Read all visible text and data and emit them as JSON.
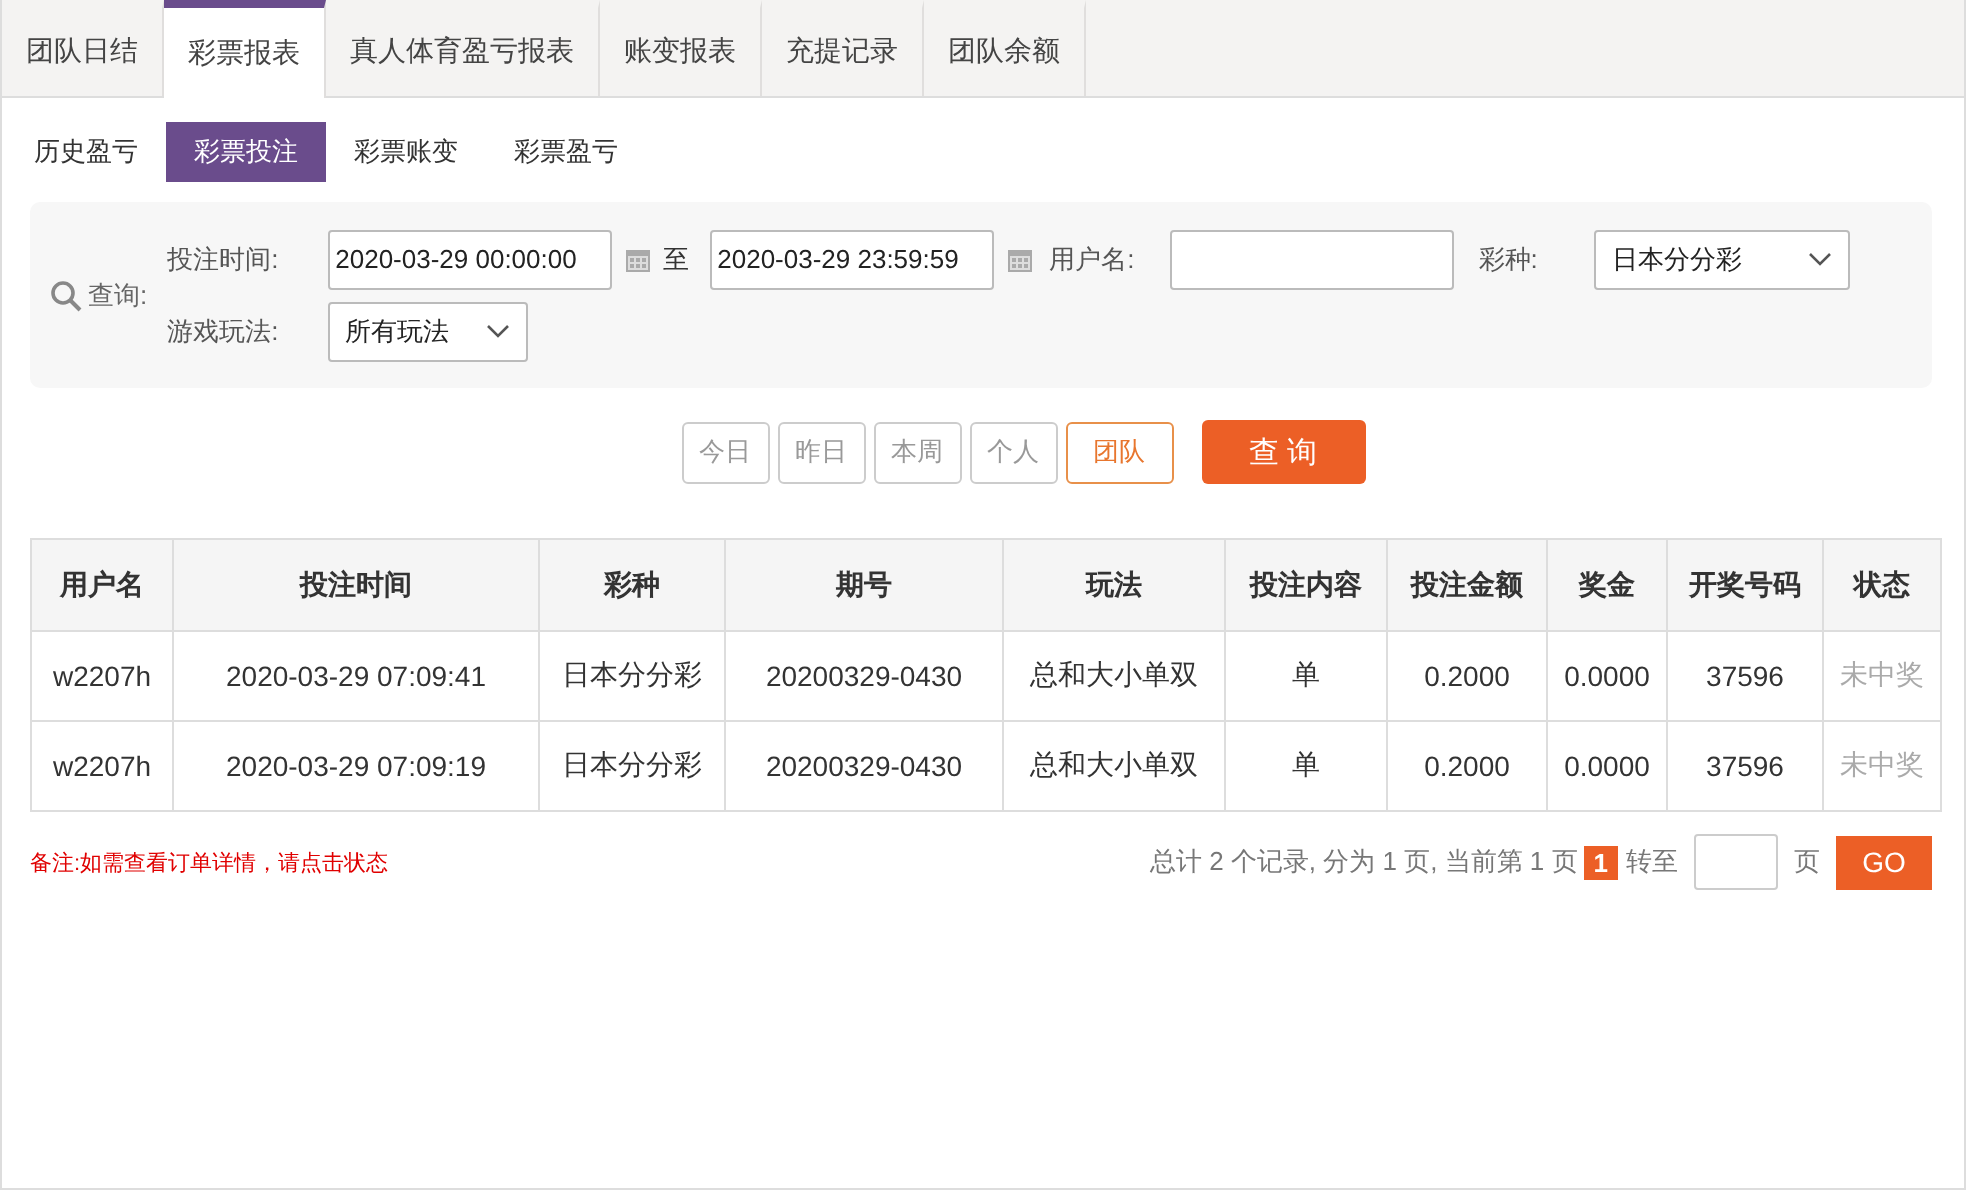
{
  "tabs": [
    {
      "label": "团队日结",
      "selected": false
    },
    {
      "label": "彩票报表",
      "selected": true
    },
    {
      "label": "真人体育盈亏报表",
      "selected": false
    },
    {
      "label": "账变报表",
      "selected": false
    },
    {
      "label": "充提记录",
      "selected": false
    },
    {
      "label": "团队余额",
      "selected": false
    }
  ],
  "subtabs": [
    {
      "label": "历史盈亏",
      "selected": false
    },
    {
      "label": "彩票投注",
      "selected": true
    },
    {
      "label": "彩票账变",
      "selected": false
    },
    {
      "label": "彩票盈亏",
      "selected": false
    }
  ],
  "filter": {
    "title": "查询:",
    "bet_time_label": "投注时间:",
    "start": "2020-03-29 00:00:00",
    "to_label": "至",
    "end": "2020-03-29 23:59:59",
    "username_label": "用户名:",
    "lottery_label": "彩种:",
    "lottery": "日本分分彩",
    "play_label": "游戏玩法:",
    "play": "所有玩法"
  },
  "quick_buttons": [
    {
      "label": "今日",
      "selected": false
    },
    {
      "label": "昨日",
      "selected": false
    },
    {
      "label": "本周",
      "selected": false
    },
    {
      "label": "个人",
      "selected": false
    },
    {
      "label": "团队",
      "selected": true
    }
  ],
  "query_button": "查 询",
  "table": {
    "columns": [
      "用户名",
      "投注时间",
      "彩种",
      "期号",
      "玩法",
      "投注内容",
      "投注金额",
      "奖金",
      "开奖号码",
      "状态"
    ],
    "rows": [
      [
        "w2207h",
        "2020-03-29 07:09:41",
        "日本分分彩",
        "20200329-0430",
        "总和大小单双",
        "单",
        "0.2000",
        "0.0000",
        "37596",
        "未中奖"
      ],
      [
        "w2207h",
        "2020-03-29 07:09:19",
        "日本分分彩",
        "20200329-0430",
        "总和大小单双",
        "单",
        "0.2000",
        "0.0000",
        "37596",
        "未中奖"
      ]
    ]
  },
  "note": "备注:如需查看订单详情，请点击状态",
  "pagination": {
    "summary": "总计 2 个记录, 分为 1 页, 当前第 1 页",
    "pages": [
      {
        "label": "1",
        "selected": true
      }
    ],
    "goto_label": "转至",
    "page_unit": "页",
    "go": "GO"
  }
}
